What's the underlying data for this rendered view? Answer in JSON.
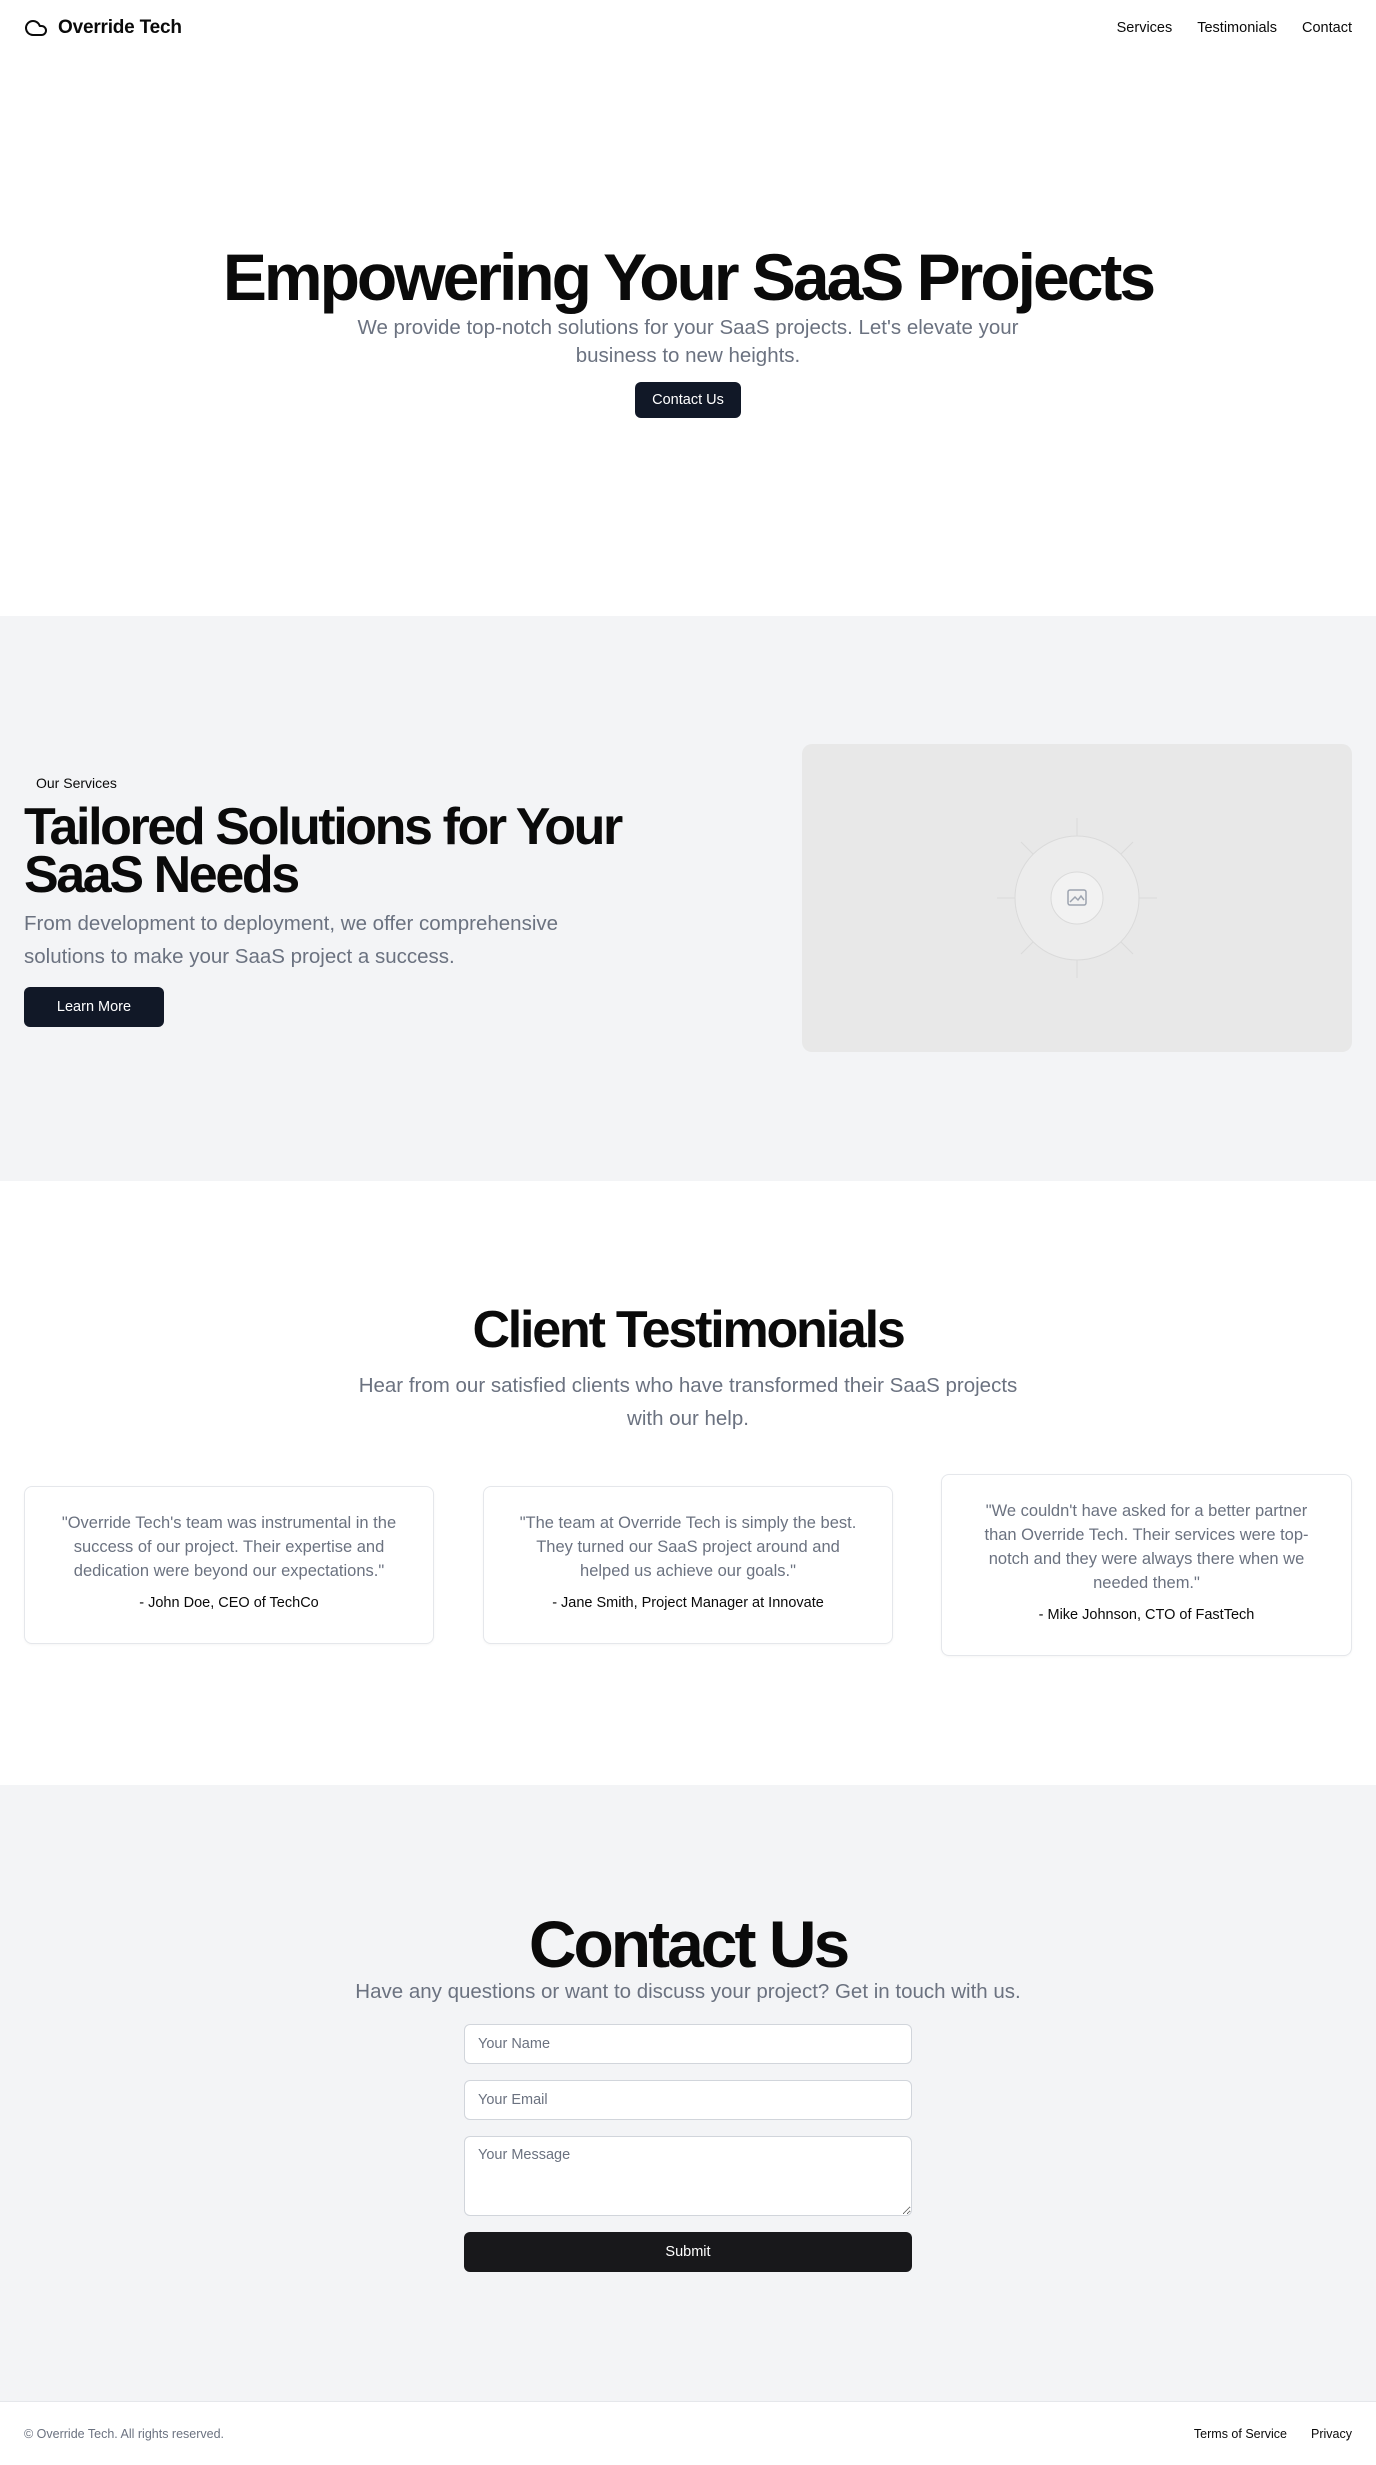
{
  "header": {
    "brand": "Override Tech",
    "logo_icon": "cloud-icon",
    "nav": [
      "Services",
      "Testimonials",
      "Contact"
    ]
  },
  "hero": {
    "title": "Empowering Your SaaS Projects",
    "subtitle": "We provide top-notch solutions for your SaaS projects. Let's elevate your business to new heights.",
    "cta": "Contact Us"
  },
  "services": {
    "kicker": "Our Services",
    "title": "Tailored Solutions for Your SaaS Needs",
    "text": "From development to deployment, we offer comprehensive solutions to make your SaaS project a success.",
    "cta": "Learn More",
    "image_icon": "image-placeholder-icon"
  },
  "testimonials": {
    "title": "Client Testimonials",
    "subtitle": "Hear from our satisfied clients who have transformed their SaaS projects with our help.",
    "items": [
      {
        "quote": "\"Override Tech's team was instrumental in the success of our project. Their expertise and dedication were beyond our expectations.\"",
        "author": "- John Doe, CEO of TechCo"
      },
      {
        "quote": "\"The team at Override Tech is simply the best. They turned our SaaS project around and helped us achieve our goals.\"",
        "author": "- Jane Smith, Project Manager at Innovate"
      },
      {
        "quote": "\"We couldn't have asked for a better partner than Override Tech. Their services were top-notch and they were always there when we needed them.\"",
        "author": "- Mike Johnson, CTO of FastTech"
      }
    ]
  },
  "contact": {
    "title": "Contact Us",
    "subtitle": "Have any questions or want to discuss your project? Get in touch with us.",
    "name_placeholder": "Your Name",
    "email_placeholder": "Your Email",
    "message_placeholder": "Your Message",
    "submit": "Submit"
  },
  "footer": {
    "copyright": "© Override Tech. All rights reserved.",
    "links": [
      "Terms of Service",
      "Privacy"
    ]
  },
  "colors": {
    "primary_button": "#111827",
    "submit_button": "#18181b",
    "muted_text": "#6b7280",
    "section_bg": "#f3f4f6"
  }
}
